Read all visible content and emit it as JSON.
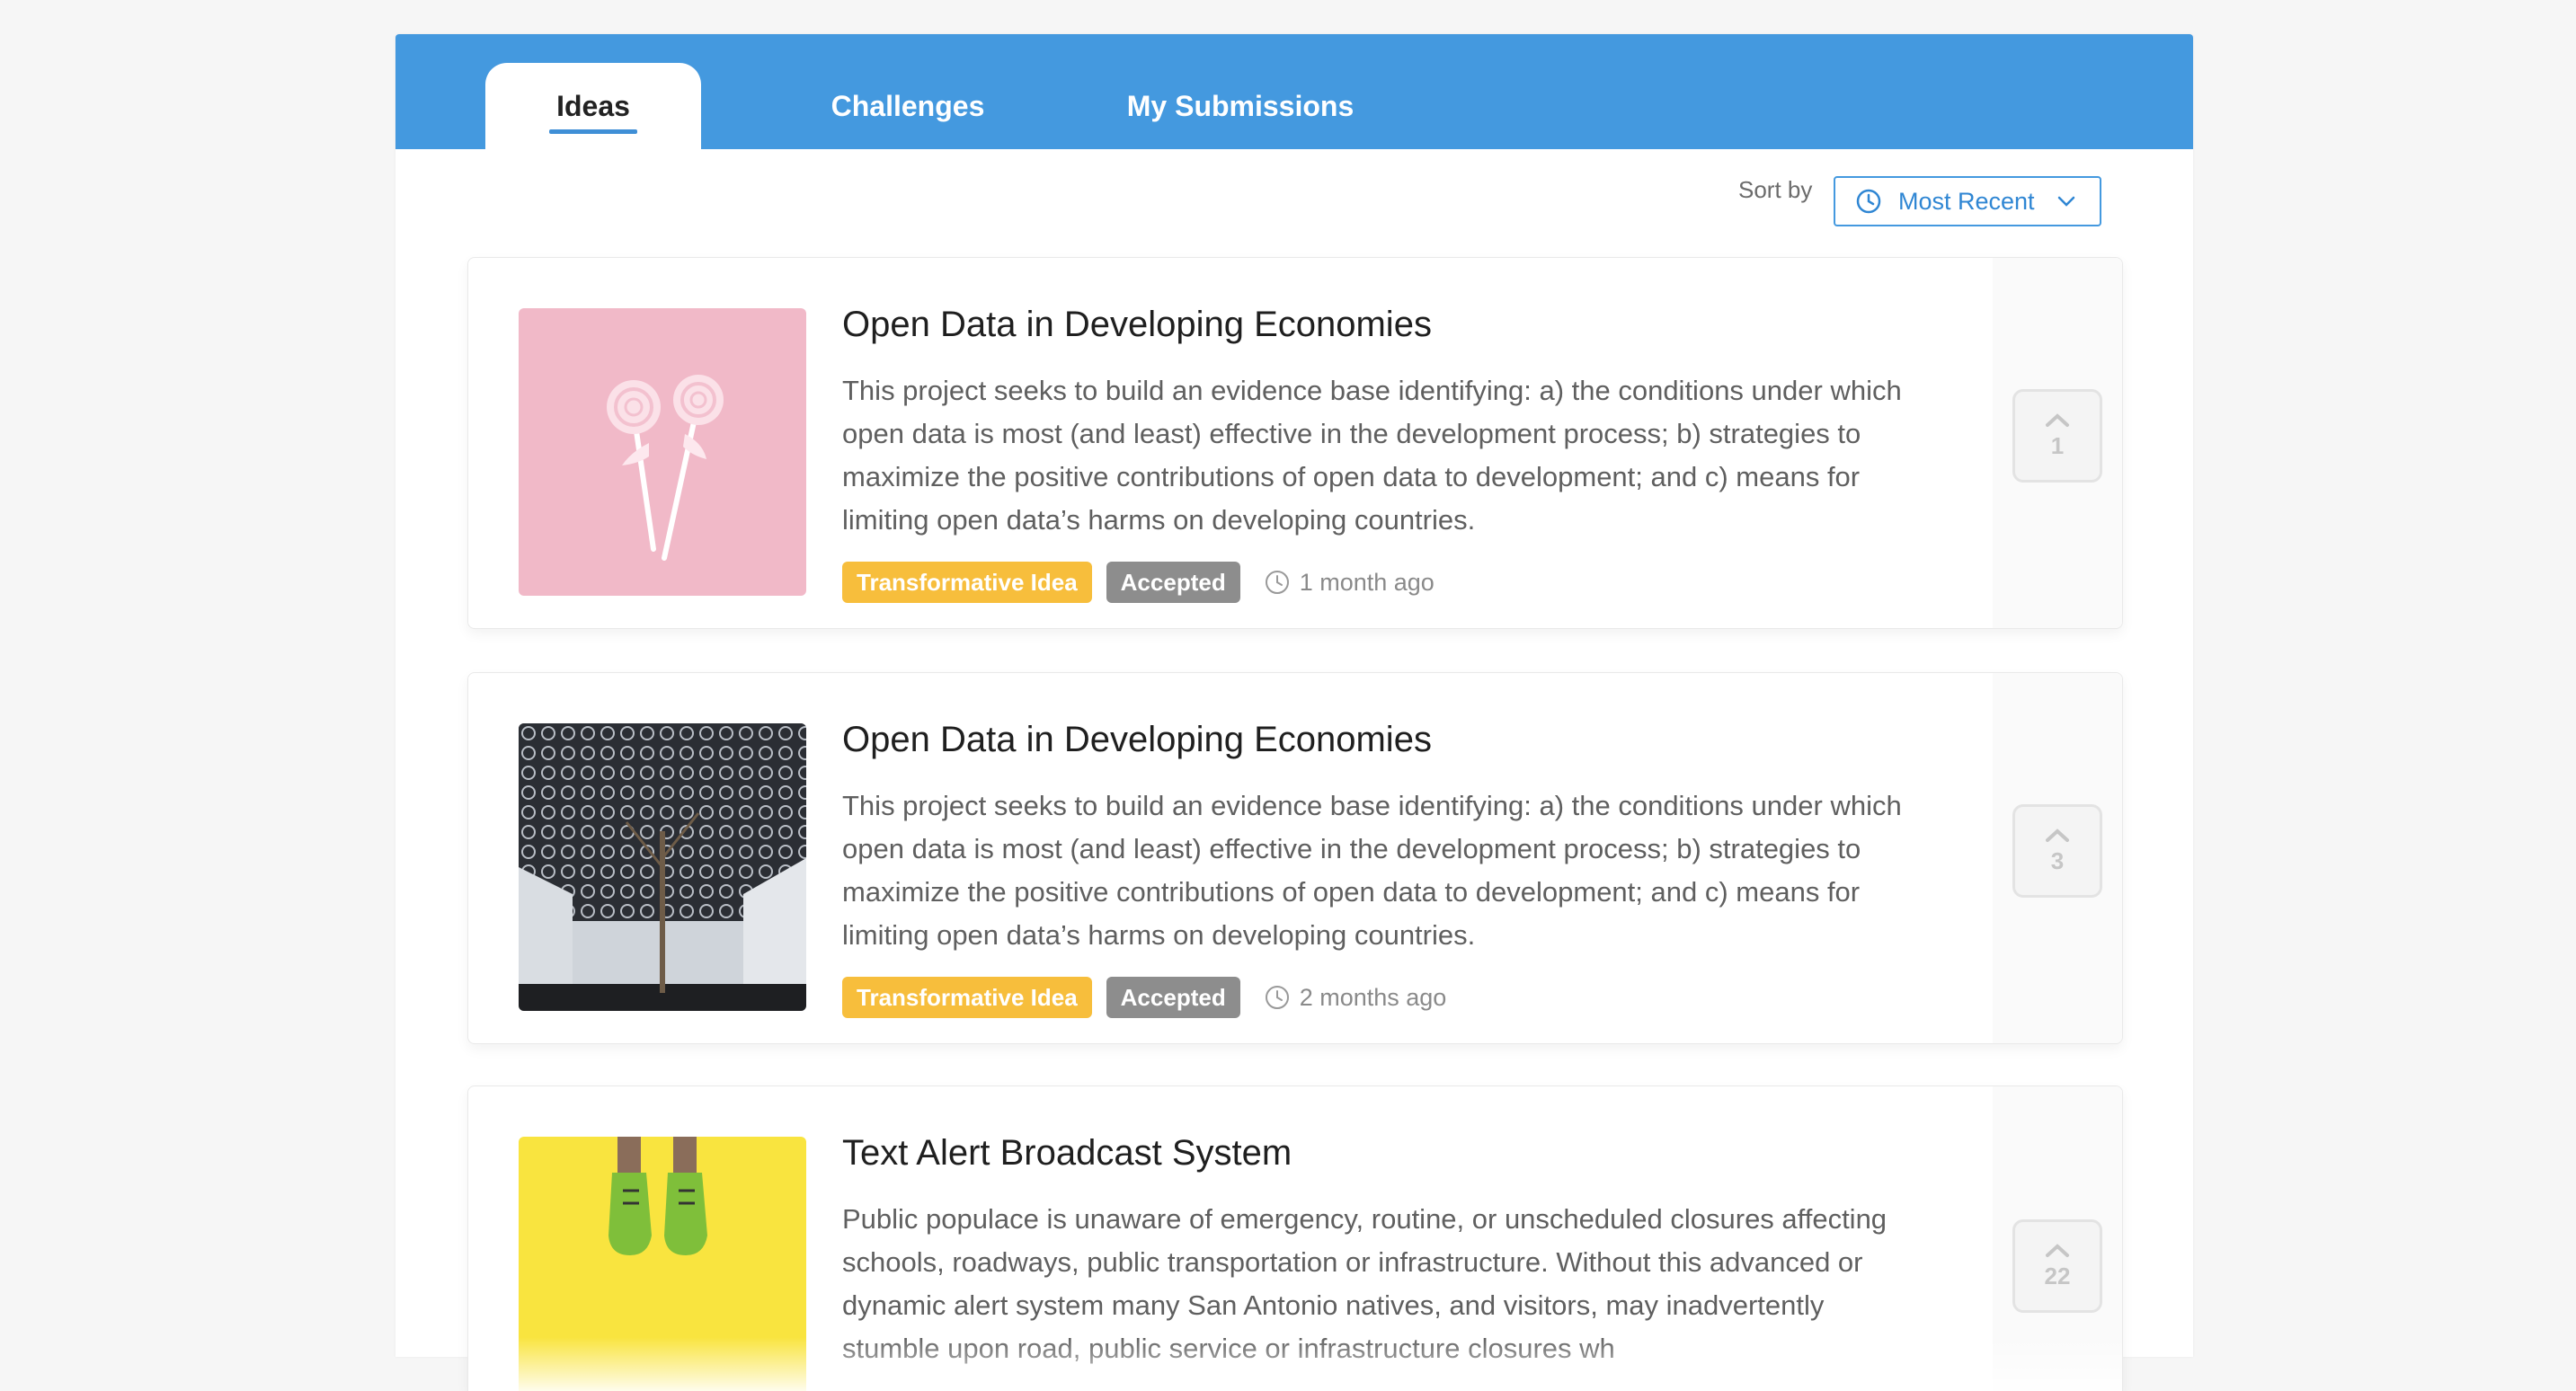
{
  "tabs": [
    {
      "label": "Ideas",
      "active": true
    },
    {
      "label": "Challenges",
      "active": false
    },
    {
      "label": "My Submissions",
      "active": false
    }
  ],
  "sort": {
    "label": "Sort by",
    "value": "Most Recent"
  },
  "colors": {
    "brand": "#4499df",
    "tag_yellow": "#f7be3c",
    "tag_gray": "#8d8d8d"
  },
  "ideas": [
    {
      "title": "Open Data in Developing Economies",
      "description": "This project seeks to build an evidence base identifying: a) the conditions under which open data is most (and least) effective in the development process; b) strategies to maximize the positive contributions of open data to development; and c) means for limiting open data’s harms on developing countries.",
      "tags": [
        "Transformative Idea",
        "Accepted"
      ],
      "time": "1 month ago",
      "votes": "1",
      "image": "pink-lollipops-image"
    },
    {
      "title": "Open Data in Developing Economies",
      "description": "This project seeks to build an evidence base identifying: a) the conditions under which open data is most (and least) effective in the development process; b) strategies to maximize the positive contributions of open data to development; and c) means for limiting open data’s harms on developing countries.",
      "tags": [
        "Transformative Idea",
        "Accepted"
      ],
      "time": "2 months ago",
      "votes": "3",
      "image": "lattice-dome-image"
    },
    {
      "title": "Text Alert Broadcast System",
      "description": "Public populace is unaware of emergency, routine, or unscheduled closures affecting schools, roadways, public transportation or infrastructure. Without this advanced or dynamic alert system many San Antonio natives, and visitors, may inadvertently stumble upon road, public service or infrastructure closures wh",
      "tags": [],
      "time": "",
      "votes": "22",
      "image": "yellow-sneakers-image"
    }
  ]
}
